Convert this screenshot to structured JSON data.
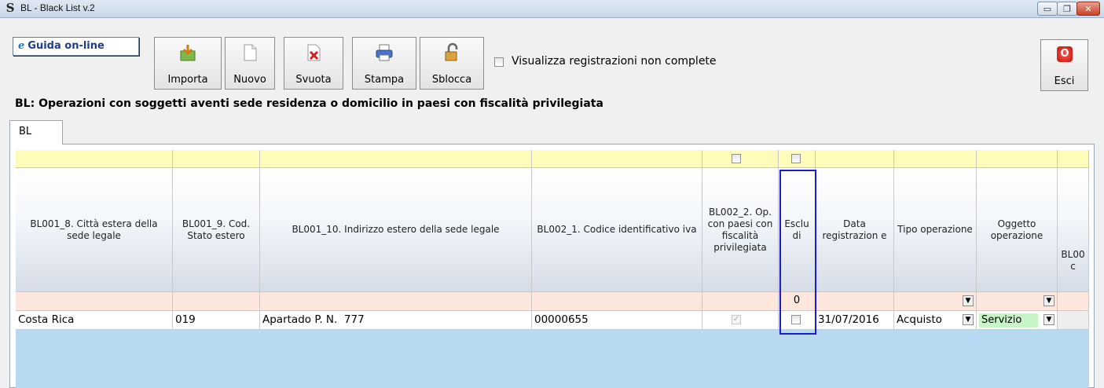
{
  "window": {
    "title": "BL - Black List v.2",
    "app_icon": "S",
    "minimize": "▭",
    "maximize": "❐",
    "close": "✕"
  },
  "toolbar": {
    "guida_label": "Guida on-line",
    "guida_icon": "e",
    "buttons": [
      {
        "label": "Importa",
        "icon": "import-icon"
      },
      {
        "label": "Nuovo",
        "icon": "new-document-icon"
      },
      {
        "label": "Svuota",
        "icon": "clear-icon"
      },
      {
        "label": "Stampa",
        "icon": "printer-icon"
      },
      {
        "label": "Sblocca",
        "icon": "unlock-icon"
      }
    ],
    "checkbox_label": "Visualizza registrazioni non complete",
    "esci_label": "Esci",
    "esci_icon": "O"
  },
  "heading": "BL: Operazioni con soggetti aventi sede residenza o domicilio in paesi con fiscalità privilegiata",
  "tab": {
    "label": "BL"
  },
  "grid": {
    "columns": [
      {
        "key": "citta",
        "header": "BL001_8. Città estera della sede legale"
      },
      {
        "key": "stato",
        "header": "BL001_9. Cod. Stato estero"
      },
      {
        "key": "indirizzo",
        "header": "BL001_10. Indirizzo estero della sede legale"
      },
      {
        "key": "iva",
        "header": "BL002_1. Codice identificativo iva"
      },
      {
        "key": "op",
        "header": "BL002_2. Op. con paesi con fiscalità privilegiata"
      },
      {
        "key": "esclu",
        "header": "Esclu di"
      },
      {
        "key": "data",
        "header": "Data registrazion e"
      },
      {
        "key": "tipo",
        "header": "Tipo operazione"
      },
      {
        "key": "oggetto",
        "header": "Oggetto operazione"
      },
      {
        "key": "extra",
        "header": "BL00 c"
      }
    ],
    "filter_row": {
      "esclu_count": "0"
    },
    "rows": [
      {
        "citta": "Costa Rica",
        "stato": "019",
        "indirizzo": "Apartado P. N.  777",
        "iva": "00000655",
        "op_checked": true,
        "esclu_checked": false,
        "data": "31/07/2016",
        "tipo": "Acquisto",
        "oggetto": "Servizio"
      }
    ]
  },
  "colors": {
    "yellow_row": "#fffbb9",
    "filter_row": "#fde6db",
    "grid_background": "#b8daf0",
    "highlight_border": "#1b1bd6",
    "servizio_bg": "#c6f5c6"
  }
}
